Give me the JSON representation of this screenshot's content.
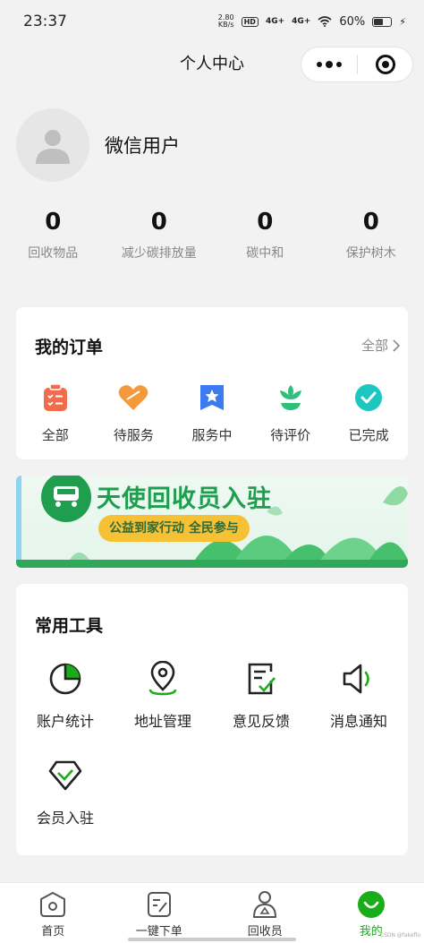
{
  "status_bar": {
    "time": "23:37",
    "net_speed_value": "2.80",
    "net_speed_unit": "KB/s",
    "hd_badge": "HD",
    "signal1": "4G+",
    "signal2": "4G+",
    "battery": "60%",
    "battery_level": 0.6
  },
  "nav": {
    "title": "个人中心"
  },
  "profile": {
    "username": "微信用户",
    "avatar_icon": "user-silhouette-icon"
  },
  "stats": [
    {
      "value": "0",
      "label": "回收物品"
    },
    {
      "value": "0",
      "label": "减少碳排放量"
    },
    {
      "value": "0",
      "label": "碳中和"
    },
    {
      "value": "0",
      "label": "保护树木"
    }
  ],
  "orders": {
    "title": "我的订单",
    "view_all": "全部",
    "items": [
      {
        "label": "全部",
        "icon": "clipboard-list-icon",
        "color": "#f26b4b"
      },
      {
        "label": "待服务",
        "icon": "heart-icon",
        "color": "#f59a3c"
      },
      {
        "label": "服务中",
        "icon": "star-bookmark-icon",
        "color": "#3a7bf0"
      },
      {
        "label": "待评价",
        "icon": "flower-icon",
        "color": "#2ec07a"
      },
      {
        "label": "已完成",
        "icon": "check-circle-icon",
        "color": "#1ec6c0"
      }
    ]
  },
  "banner": {
    "title": "天使回收员入驻",
    "subtitle": "公益到家行动 全民参与"
  },
  "tools": {
    "title": "常用工具",
    "items": [
      {
        "label": "账户统计",
        "icon": "pie-chart-icon"
      },
      {
        "label": "地址管理",
        "icon": "location-pin-icon"
      },
      {
        "label": "意见反馈",
        "icon": "feedback-form-icon"
      },
      {
        "label": "消息通知",
        "icon": "speaker-icon"
      },
      {
        "label": "会员入驻",
        "icon": "diamond-check-icon"
      }
    ]
  },
  "tabs": [
    {
      "label": "首页",
      "icon": "home-icon",
      "active": false
    },
    {
      "label": "一键下单",
      "icon": "order-form-icon",
      "active": false
    },
    {
      "label": "回收员",
      "icon": "recycler-person-icon",
      "active": false
    },
    {
      "label": "我的",
      "icon": "smile-profile-icon",
      "active": true
    }
  ],
  "colors": {
    "accent": "#1aad19",
    "tool_accent": "#1aad19",
    "banner_title": "#1e9e4e"
  },
  "watermark": "CSDN @fakeflo"
}
